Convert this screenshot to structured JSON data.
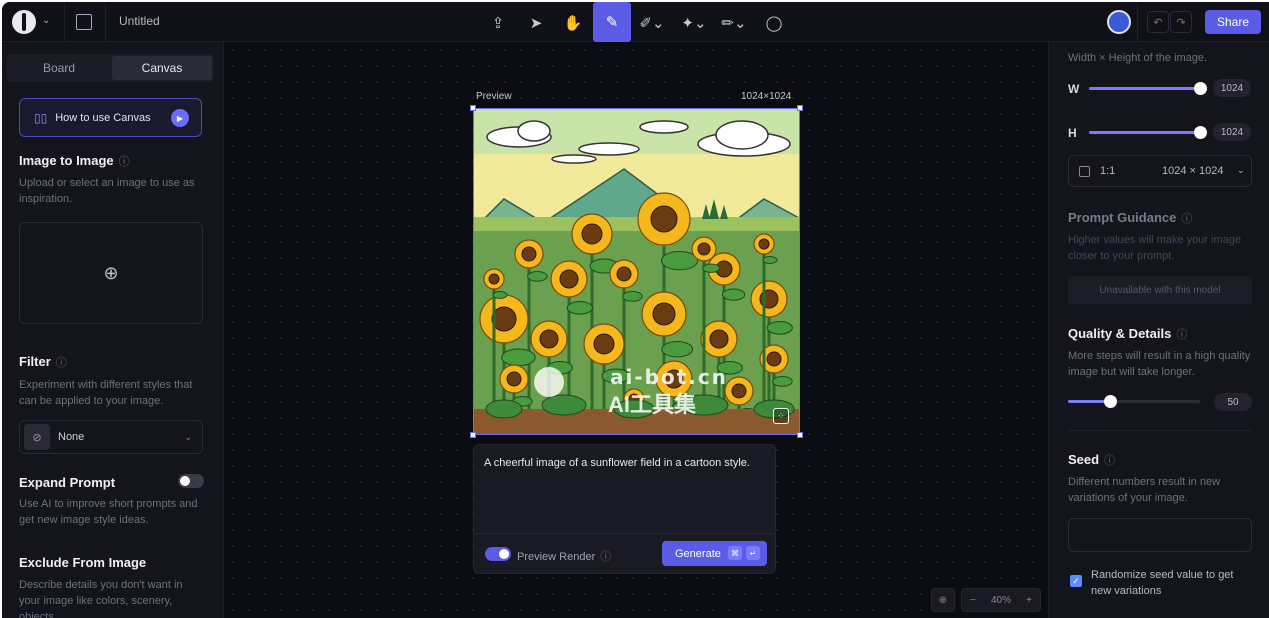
{
  "header": {
    "title": "Untitled",
    "share_label": "Share",
    "tools": [
      "upload-icon",
      "pointer-icon",
      "hand-icon",
      "image-edit-icon",
      "brush-icon",
      "mask-icon",
      "pencil-icon",
      "comment-icon"
    ]
  },
  "left_panel": {
    "tabs": [
      "Board",
      "Canvas"
    ],
    "active_tab": "Canvas",
    "howto_label": "How to use Canvas",
    "image_to_image": {
      "title": "Image to Image",
      "desc": "Upload or select an image to use as inspiration."
    },
    "filter": {
      "title": "Filter",
      "desc": "Experiment with different styles that can be applied to your image.",
      "value": "None"
    },
    "expand_prompt": {
      "title": "Expand Prompt",
      "desc": "Use AI to improve short prompts and get new image style ideas.",
      "on": false
    },
    "exclude": {
      "title": "Exclude From Image",
      "desc": "Describe details you don't want in your image like colors, scenery, objects."
    }
  },
  "canvas": {
    "preview_label": "Preview",
    "size_label": "1024×1024",
    "watermark_main": "ai-bot.cn",
    "watermark_sub": "AI工具集",
    "prompt_text": "A cheerful image of a sunflower field in a cartoon style.",
    "preview_render_label": "Preview Render",
    "preview_render_on": true,
    "generate_label": "Generate",
    "zoom_label": "40%",
    "zoom_minus": "−",
    "zoom_plus": "+"
  },
  "right_panel": {
    "dimensions_desc": "Width × Height of the image.",
    "w_label": "W",
    "w_value": "1024",
    "h_label": "H",
    "h_value": "1024",
    "ratio_label": "1:1",
    "ratio_size": "1024 × 1024",
    "prompt_guidance": {
      "title": "Prompt Guidance",
      "desc": "Higher values will make your image closer to your prompt.",
      "unavailable": "Unavailable with this model"
    },
    "quality": {
      "title": "Quality & Details",
      "desc": "More steps will result in a high quality image but will take longer.",
      "value": "50",
      "fraction": 0.2
    },
    "seed": {
      "title": "Seed",
      "desc": "Different numbers result in new variations of your image.",
      "randomize_label": "Randomize seed value to get new variations",
      "randomize_checked": true
    }
  },
  "colors": {
    "accent": "#5b5be6",
    "background": "#0b0b12",
    "panel": "#14141c"
  }
}
